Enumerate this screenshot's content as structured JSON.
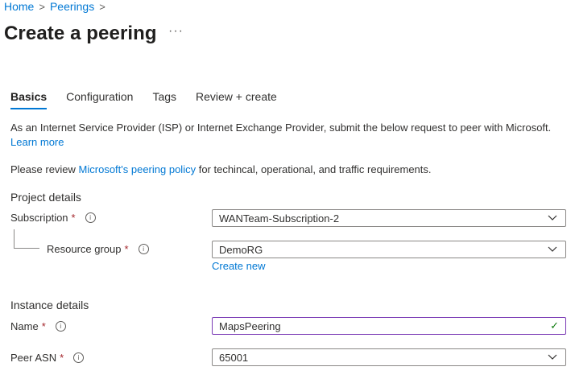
{
  "breadcrumb": {
    "home": "Home",
    "peerings": "Peerings",
    "separator": ">"
  },
  "page": {
    "title": "Create a peering",
    "more": "···"
  },
  "tabs": [
    {
      "label": "Basics",
      "active": true
    },
    {
      "label": "Configuration",
      "active": false
    },
    {
      "label": "Tags",
      "active": false
    },
    {
      "label": "Review + create",
      "active": false
    }
  ],
  "intro": {
    "text": "As an Internet Service Provider (ISP) or Internet Exchange Provider, submit the below request to peer with Microsoft.",
    "learn_more": "Learn more"
  },
  "policy": {
    "prefix": "Please review ",
    "link": "Microsoft's peering policy",
    "suffix": " for techincal, operational, and traffic requirements."
  },
  "project": {
    "title": "Project details",
    "subscription": {
      "label": "Subscription",
      "required": "*",
      "value": "WANTeam-Subscription-2"
    },
    "resource_group": {
      "label": "Resource group",
      "required": "*",
      "value": "DemoRG",
      "create_new": "Create new"
    }
  },
  "instance": {
    "title": "Instance details",
    "name": {
      "label": "Name",
      "required": "*",
      "value": "MapsPeering"
    },
    "peer_asn": {
      "label": "Peer ASN",
      "required": "*",
      "value": "65001"
    }
  },
  "colors": {
    "accent": "#0078d4",
    "required": "#a4262c",
    "valid": "#107c10"
  }
}
